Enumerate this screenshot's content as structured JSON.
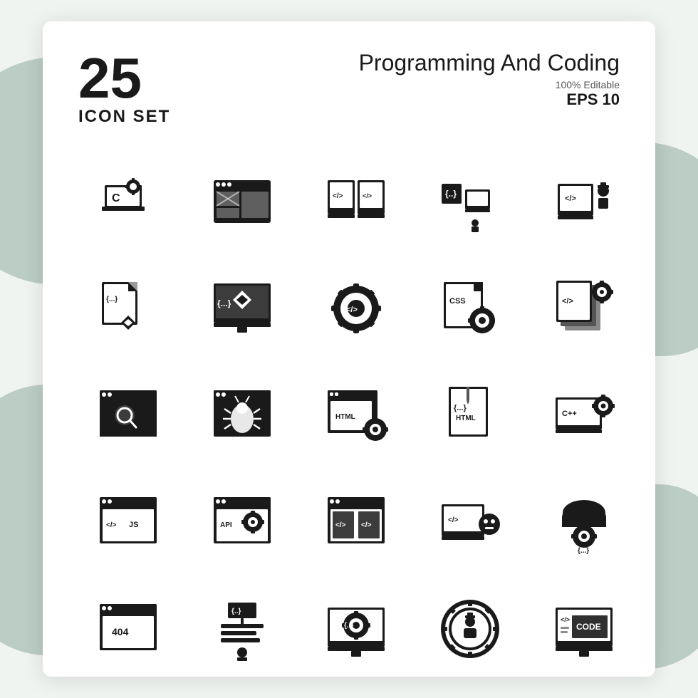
{
  "header": {
    "number": "25",
    "icon_set_label": "ICON SET",
    "title": "Programming And Coding",
    "editable": "100% Editable",
    "eps": "EPS 10"
  },
  "icons": [
    {
      "id": 1,
      "name": "c-language-settings",
      "label": "C settings"
    },
    {
      "id": 2,
      "name": "web-layout",
      "label": "web layout"
    },
    {
      "id": 3,
      "name": "dual-monitor-code",
      "label": "dual monitor code"
    },
    {
      "id": 4,
      "name": "code-learning",
      "label": "code learning"
    },
    {
      "id": 5,
      "name": "developer-monitor",
      "label": "developer monitor"
    },
    {
      "id": 6,
      "name": "code-file-diamond",
      "label": "code file diamond"
    },
    {
      "id": 7,
      "name": "diamond-code-monitor",
      "label": "diamond code monitor"
    },
    {
      "id": 8,
      "name": "code-gear",
      "label": "code gear"
    },
    {
      "id": 9,
      "name": "css-settings",
      "label": "CSS settings"
    },
    {
      "id": 10,
      "name": "layers-gear",
      "label": "layers gear"
    },
    {
      "id": 11,
      "name": "browser-search",
      "label": "browser search"
    },
    {
      "id": 12,
      "name": "bug-browser",
      "label": "bug browser"
    },
    {
      "id": 13,
      "name": "html-settings",
      "label": "HTML settings"
    },
    {
      "id": 14,
      "name": "html-file",
      "label": "HTML file"
    },
    {
      "id": 15,
      "name": "cpp-settings",
      "label": "C++ settings"
    },
    {
      "id": 16,
      "name": "js-browser",
      "label": "JS browser"
    },
    {
      "id": 17,
      "name": "api-settings",
      "label": "API settings"
    },
    {
      "id": 18,
      "name": "code-window",
      "label": "code window"
    },
    {
      "id": 19,
      "name": "robot-code",
      "label": "robot code"
    },
    {
      "id": 20,
      "name": "cloud-settings",
      "label": "cloud settings"
    },
    {
      "id": 21,
      "name": "404-browser",
      "label": "404 browser"
    },
    {
      "id": 22,
      "name": "developer-code",
      "label": "developer code"
    },
    {
      "id": 23,
      "name": "monitor-gear",
      "label": "monitor gear"
    },
    {
      "id": 24,
      "name": "gear-person",
      "label": "gear person"
    },
    {
      "id": 25,
      "name": "code-monitor",
      "label": "CODE monitor"
    }
  ]
}
